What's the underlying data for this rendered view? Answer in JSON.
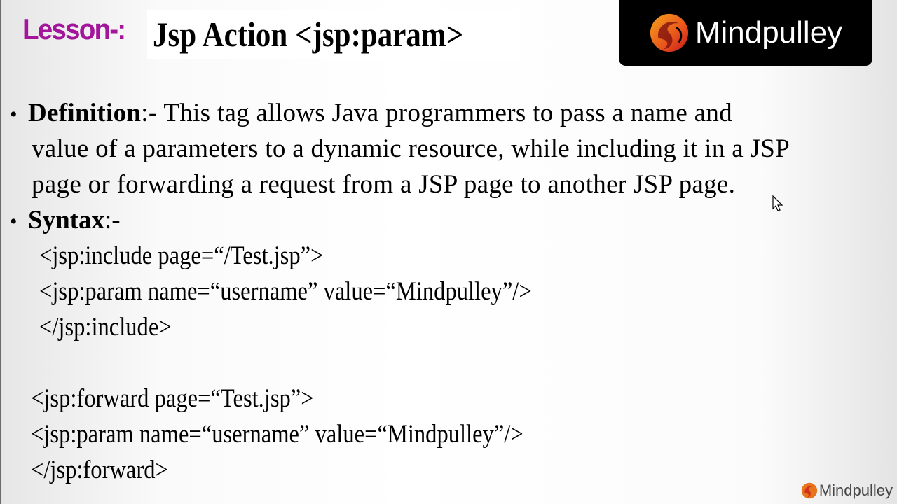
{
  "header": {
    "lesson_label": "Lesson-:",
    "title": "Jsp Action <jsp:param>"
  },
  "brand": {
    "name": "Mindpulley",
    "watermark": "Mindpulley",
    "logo_colors": [
      "#f7a21b",
      "#e8541c",
      "#c4161c"
    ]
  },
  "definition": {
    "label": "Definition",
    "separator": ":-",
    "lines": [
      "This tag allows Java programmers to pass a name and",
      "value of a parameters to a dynamic resource, while including it in a JSP",
      "page or forwarding a request from a JSP page to another JSP page."
    ]
  },
  "syntax": {
    "label": "Syntax",
    "separator": ":-",
    "include_block": [
      "<jsp:include page=“/Test.jsp”>",
      "<jsp:param name=“username” value=“Mindpulley”/>",
      "</jsp:include>"
    ],
    "forward_block": [
      "<jsp:forward page=“Test.jsp”>",
      "<jsp:param name=“username” value=“Mindpulley”/>",
      "</jsp:forward>"
    ]
  }
}
